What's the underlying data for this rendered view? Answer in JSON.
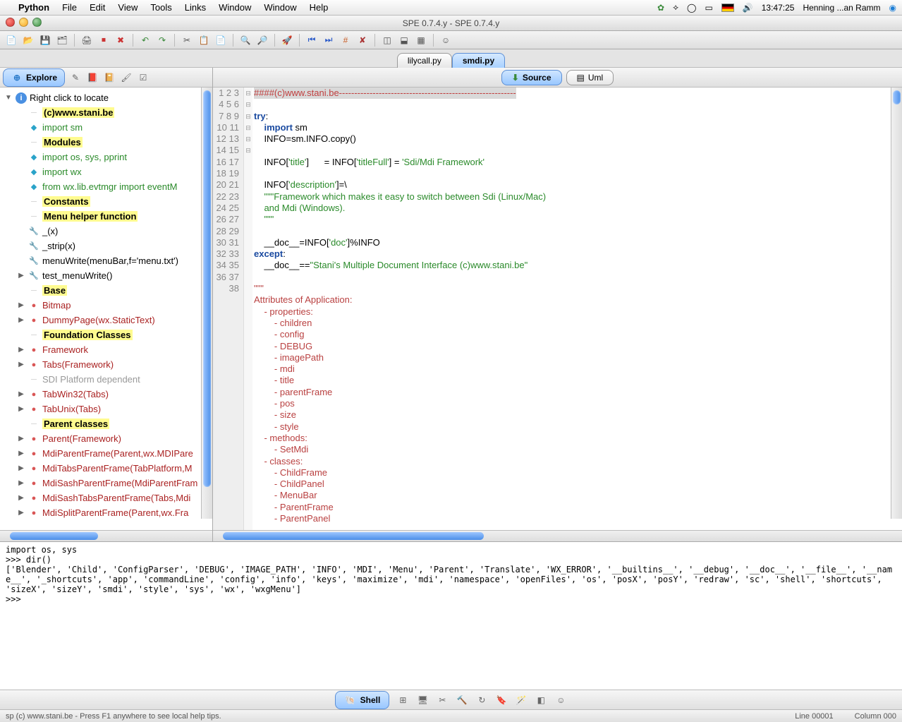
{
  "menubar": {
    "apple": "",
    "appname": "Python",
    "items": [
      "File",
      "Edit",
      "View",
      "Tools",
      "Links",
      "Window",
      "Window",
      "Help"
    ],
    "clock": "13:47:25",
    "user": "Henning ...an Ramm"
  },
  "window": {
    "title": "SPE 0.7.4.y - SPE 0.7.4.y"
  },
  "doctabs": [
    {
      "label": "lilycall.py",
      "active": false
    },
    {
      "label": "smdi.py",
      "active": true
    }
  ],
  "left": {
    "tab_explore": "Explore",
    "hint": "Right click to locate",
    "tree": [
      {
        "d": 0,
        "ind": 0,
        "kind": "info",
        "text": "Right click to locate"
      },
      {
        "d": 0,
        "ind": 1,
        "kind": "hl",
        "text": "(c)www.stani.be"
      },
      {
        "d": 0,
        "ind": 1,
        "kind": "imp",
        "text": "import sm"
      },
      {
        "d": 0,
        "ind": 1,
        "kind": "hl",
        "text": "Modules"
      },
      {
        "d": 0,
        "ind": 1,
        "kind": "imp",
        "text": "import  os, sys, pprint"
      },
      {
        "d": 0,
        "ind": 1,
        "kind": "imp",
        "text": "import  wx"
      },
      {
        "d": 0,
        "ind": 1,
        "kind": "imp",
        "text": "from    wx.lib.evtmgr import eventM"
      },
      {
        "d": 0,
        "ind": 1,
        "kind": "hl",
        "text": "Constants"
      },
      {
        "d": 0,
        "ind": 1,
        "kind": "hl",
        "text": "Menu helper function"
      },
      {
        "d": 0,
        "ind": 1,
        "kind": "fn",
        "text": "_(x)"
      },
      {
        "d": 0,
        "ind": 1,
        "kind": "fn",
        "text": "_strip(x)"
      },
      {
        "d": 0,
        "ind": 1,
        "kind": "fn",
        "text": "menuWrite(menuBar,f='menu.txt')"
      },
      {
        "d": 1,
        "ind": 1,
        "kind": "fn",
        "text": "test_menuWrite()"
      },
      {
        "d": 0,
        "ind": 1,
        "kind": "hl",
        "text": "Base"
      },
      {
        "d": 1,
        "ind": 1,
        "kind": "cls",
        "text": "Bitmap"
      },
      {
        "d": 1,
        "ind": 1,
        "kind": "cls",
        "text": "DummyPage(wx.StaticText)"
      },
      {
        "d": 0,
        "ind": 1,
        "kind": "hl",
        "text": "Foundation Classes"
      },
      {
        "d": 1,
        "ind": 1,
        "kind": "cls",
        "text": "Framework"
      },
      {
        "d": 1,
        "ind": 1,
        "kind": "cls",
        "text": "Tabs(Framework)"
      },
      {
        "d": 0,
        "ind": 1,
        "kind": "dim",
        "text": "SDI Platform dependent"
      },
      {
        "d": 1,
        "ind": 1,
        "kind": "cls",
        "text": "TabWin32(Tabs)"
      },
      {
        "d": 1,
        "ind": 1,
        "kind": "cls",
        "text": "TabUnix(Tabs)"
      },
      {
        "d": 0,
        "ind": 1,
        "kind": "hl",
        "text": "Parent classes"
      },
      {
        "d": 1,
        "ind": 1,
        "kind": "cls",
        "text": "Parent(Framework)"
      },
      {
        "d": 1,
        "ind": 1,
        "kind": "cls",
        "text": "MdiParentFrame(Parent,wx.MDIPare"
      },
      {
        "d": 1,
        "ind": 1,
        "kind": "cls",
        "text": "MdiTabsParentFrame(TabPlatform,M"
      },
      {
        "d": 1,
        "ind": 1,
        "kind": "cls",
        "text": "MdiSashParentFrame(MdiParentFram"
      },
      {
        "d": 1,
        "ind": 1,
        "kind": "cls",
        "text": "MdiSashTabsParentFrame(Tabs,Mdi"
      },
      {
        "d": 1,
        "ind": 1,
        "kind": "cls",
        "text": "MdiSplitParentFrame(Parent,wx.Fra"
      }
    ]
  },
  "right": {
    "tab_source": "Source",
    "tab_uml": "Uml",
    "lines": [
      {
        "n": 1,
        "f": "",
        "html": "<span class='line1 c-com'>####(c)www.stani.be----------------------------------------------------------</span>"
      },
      {
        "n": 2,
        "f": "",
        "html": ""
      },
      {
        "n": 3,
        "f": "⊟",
        "html": "<span class='c-kw'>try</span>:"
      },
      {
        "n": 4,
        "f": "",
        "html": "    <span class='c-kw'>import</span> sm"
      },
      {
        "n": 5,
        "f": "",
        "html": "    INFO=sm.INFO.copy()"
      },
      {
        "n": 6,
        "f": "",
        "html": ""
      },
      {
        "n": 7,
        "f": "",
        "html": "    INFO[<span class='c-str'>'title'</span>]      = INFO[<span class='c-str'>'titleFull'</span>] = <span class='c-str'>'Sdi/Mdi Framework'</span>"
      },
      {
        "n": 8,
        "f": "",
        "html": ""
      },
      {
        "n": 9,
        "f": "",
        "html": "    INFO[<span class='c-str'>'description'</span>]=\\"
      },
      {
        "n": 10,
        "f": "",
        "html": "    <span class='c-str'>\"\"\"Framework which makes it easy to switch between Sdi (Linux/Mac)</span>"
      },
      {
        "n": 11,
        "f": "",
        "html": "<span class='c-str'>    and Mdi (Windows).</span>"
      },
      {
        "n": 12,
        "f": "",
        "html": "<span class='c-str'>    \"\"\"</span>"
      },
      {
        "n": 13,
        "f": "",
        "html": ""
      },
      {
        "n": 14,
        "f": "",
        "html": "    __doc__=INFO[<span class='c-str'>'doc'</span>]%INFO"
      },
      {
        "n": 15,
        "f": "⊟",
        "html": "<span class='c-kw'>except</span>:"
      },
      {
        "n": 16,
        "f": "",
        "html": "    __doc__==<span class='c-str'>\"Stani's Multiple Document Interface (c)www.stani.be\"</span>"
      },
      {
        "n": 17,
        "f": "",
        "html": ""
      },
      {
        "n": 18,
        "f": "⊟",
        "html": "<span class='c-doc'>\"\"\"</span>"
      },
      {
        "n": 19,
        "f": "",
        "html": "<span class='c-doc'>Attributes of Application:</span>"
      },
      {
        "n": 20,
        "f": "⊟",
        "html": "<span class='c-doc'>    - properties:</span>"
      },
      {
        "n": 21,
        "f": "",
        "html": "<span class='c-doc'>        - children</span>"
      },
      {
        "n": 22,
        "f": "",
        "html": "<span class='c-doc'>        - config</span>"
      },
      {
        "n": 23,
        "f": "",
        "html": "<span class='c-doc'>        - DEBUG</span>"
      },
      {
        "n": 24,
        "f": "",
        "html": "<span class='c-doc'>        - imagePath</span>"
      },
      {
        "n": 25,
        "f": "",
        "html": "<span class='c-doc'>        - mdi</span>"
      },
      {
        "n": 26,
        "f": "",
        "html": "<span class='c-doc'>        - title</span>"
      },
      {
        "n": 27,
        "f": "",
        "html": "<span class='c-doc'>        - parentFrame</span>"
      },
      {
        "n": 28,
        "f": "",
        "html": "<span class='c-doc'>        - pos</span>"
      },
      {
        "n": 29,
        "f": "",
        "html": "<span class='c-doc'>        - size</span>"
      },
      {
        "n": 30,
        "f": "",
        "html": "<span class='c-doc'>        - style</span>"
      },
      {
        "n": 31,
        "f": "⊟",
        "html": "<span class='c-doc'>    - methods:</span>"
      },
      {
        "n": 32,
        "f": "",
        "html": "<span class='c-doc'>        - SetMdi</span>"
      },
      {
        "n": 33,
        "f": "⊟",
        "html": "<span class='c-doc'>    - classes:</span>"
      },
      {
        "n": 34,
        "f": "",
        "html": "<span class='c-doc'>        - ChildFrame</span>"
      },
      {
        "n": 35,
        "f": "",
        "html": "<span class='c-doc'>        - ChildPanel</span>"
      },
      {
        "n": 36,
        "f": "",
        "html": "<span class='c-doc'>        - MenuBar</span>"
      },
      {
        "n": 37,
        "f": "",
        "html": "<span class='c-doc'>        - ParentFrame</span>"
      },
      {
        "n": 38,
        "f": "",
        "html": "<span class='c-doc'>        - ParentPanel</span>"
      }
    ]
  },
  "shell": {
    "lines": [
      "import os, sys",
      ">>> dir()",
      "['Blender', 'Child', 'ConfigParser', 'DEBUG', 'IMAGE_PATH', 'INFO', 'MDI', 'Menu', 'Parent', 'Translate', 'WX_ERROR', '__builtins__', '__debug', '__doc__', '__file__', '__name__', '_shortcuts', 'app', 'commandLine', 'config', 'info', 'keys', 'maximize', 'mdi', 'namespace', 'openFiles', 'os', 'posX', 'posY', 'redraw', 'sc', 'shell', 'shortcuts', 'sizeX', 'sizeY', 'smdi', 'style', 'sys', 'wx', 'wxgMenu']",
      ">>> "
    ]
  },
  "bottom": {
    "shell": "Shell"
  },
  "status": {
    "left": "sp  (c) www.stani.be - Press F1 anywhere to see local help tips.",
    "line": "Line 00001",
    "col": "Column 000"
  }
}
